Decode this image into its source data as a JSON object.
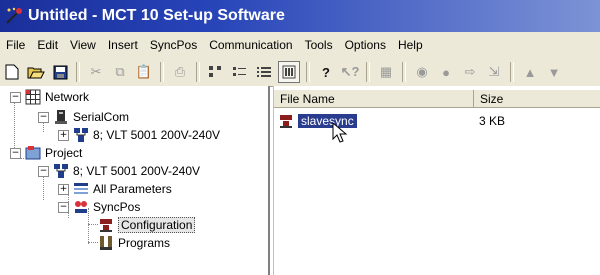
{
  "window": {
    "title": "Untitled - MCT 10 Set-up Software"
  },
  "menu": [
    "File",
    "Edit",
    "View",
    "Insert",
    "SyncPos",
    "Communication",
    "Tools",
    "Options",
    "Help"
  ],
  "toolbar": {
    "icons": [
      "new-icon",
      "open-icon",
      "save-icon",
      "cut-icon",
      "copy-icon",
      "paste-icon",
      "print-icon",
      "large-icons-icon",
      "small-icons-icon",
      "list-icon",
      "details-icon",
      "help-icon",
      "context-help-icon",
      "grid-icon",
      "connect-icon",
      "record-icon",
      "export-icon",
      "import-icon",
      "up-arrow-icon",
      "down-arrow-icon"
    ]
  },
  "tree": {
    "network": "Network",
    "serialcom": "SerialCom",
    "drive1": "8; VLT 5001 200V-240V",
    "project": "Project",
    "drive2": "8; VLT 5001 200V-240V",
    "all_parameters": "All Parameters",
    "syncpos": "SyncPos",
    "configuration": "Configuration",
    "programs": "Programs"
  },
  "list": {
    "col_name": "File Name",
    "col_size": "Size",
    "rows": [
      {
        "name": "slavesync",
        "size": "3 KB"
      }
    ]
  }
}
